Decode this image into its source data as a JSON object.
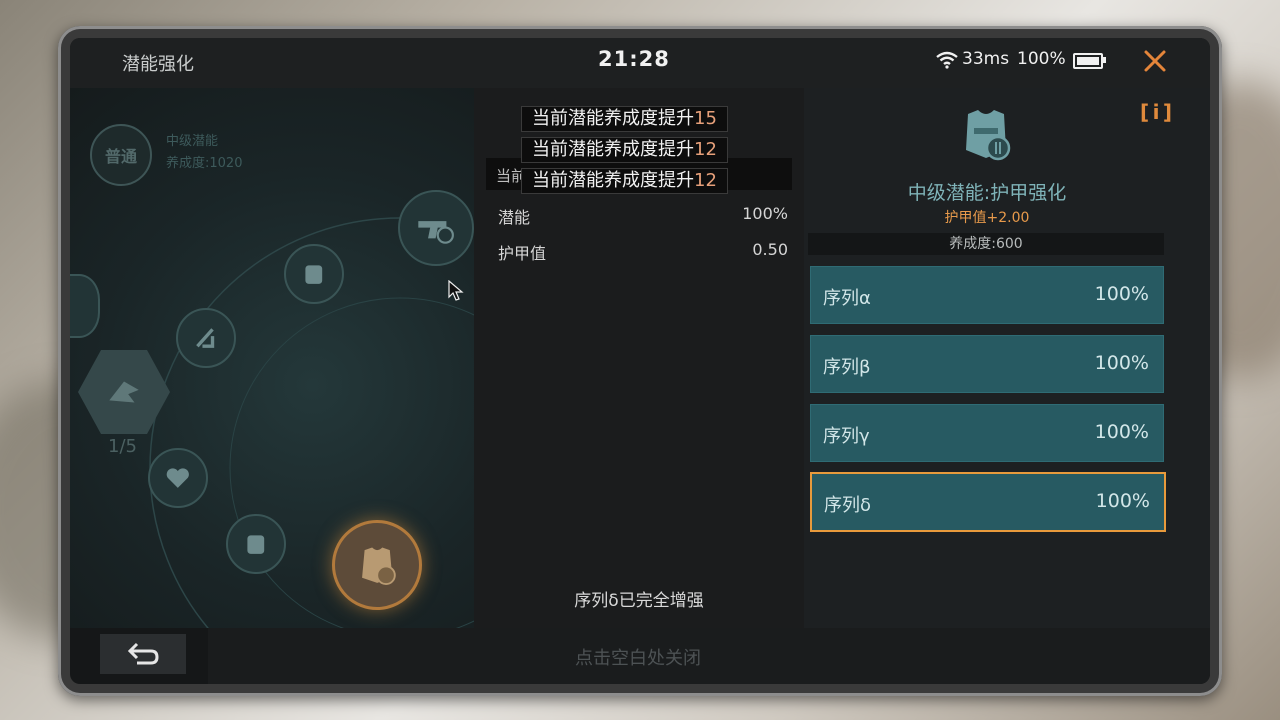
{
  "status_bar": {
    "title": "潜能强化",
    "time": "21:28",
    "ping": "33ms",
    "battery": "100%",
    "close_icon": "close-icon"
  },
  "left_panel": {
    "grade_badge": "普通",
    "node_name": "中级潜能",
    "node_cultivation": "养成度:1020",
    "progress": "1/5"
  },
  "middle_panel": {
    "toasts": [
      {
        "text": "当前潜能养成度提升",
        "value": "15"
      },
      {
        "text": "当前潜能养成度提升",
        "value": "12"
      },
      {
        "text": "当前潜能养成度提升",
        "value": "12"
      }
    ],
    "toast_back_text": "当前",
    "stats": [
      {
        "label": "潜能",
        "value": "100%"
      },
      {
        "label": "护甲值",
        "value": "0.50"
      }
    ],
    "complete_text": "序列δ已完全增强"
  },
  "right_panel": {
    "info_label": "i",
    "skill_name": "中级潜能:护甲强化",
    "skill_bonus": "护甲值+2.00",
    "skill_level": "养成度:600",
    "sequences": [
      {
        "label": "序列α",
        "value": "100%"
      },
      {
        "label": "序列β",
        "value": "100%"
      },
      {
        "label": "序列γ",
        "value": "100%"
      },
      {
        "label": "序列δ",
        "value": "100%"
      }
    ]
  },
  "bottom_bar": {
    "hint": "点击空白处关闭"
  },
  "colors": {
    "accent_orange": "#e89a3c",
    "sequence_teal": "#275a62",
    "skill_teal": "#7fb3b8"
  }
}
